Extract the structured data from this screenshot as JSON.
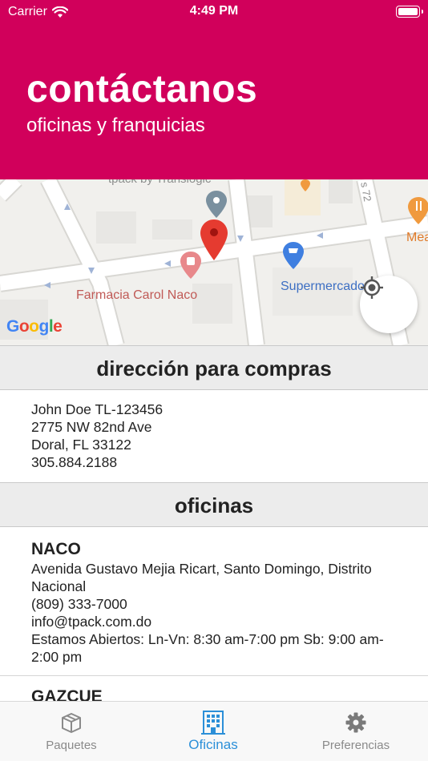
{
  "status_bar": {
    "carrier": "Carrier",
    "time": "4:49 PM"
  },
  "header": {
    "title": "contáctanos",
    "subtitle": "oficinas y franquicias"
  },
  "map": {
    "labels": {
      "farmacia": "Farmacia Carol Naco",
      "supermercado": "Supermercado ...o",
      "tpack": "tpack by Translogic",
      "me": "Mea",
      "street": "s 72"
    },
    "logo": "Google",
    "locate_icon": "crosshair-icon"
  },
  "sections": {
    "compras": "dirección para compras",
    "oficinas": "oficinas"
  },
  "shipping_address": {
    "line1": "John Doe TL-123456",
    "line2": "2775 NW 82nd Ave",
    "line3": "Doral, FL 33122",
    "phone": "305.884.2188"
  },
  "offices": [
    {
      "name": "NACO",
      "address": "Avenida Gustavo Mejia Ricart, Santo Domingo, Distrito Nacional",
      "phone": "(809) 333-7000",
      "email": "info@tpack.com.do",
      "hours": "Estamos Abiertos: Ln-Vn: 8:30 am-7:00 pm Sb: 9:00 am-2:00 pm"
    },
    {
      "name": "GAZCUE"
    }
  ],
  "tabs": [
    {
      "label": "Paquetes",
      "icon": "package-icon"
    },
    {
      "label": "Oficinas",
      "icon": "building-icon",
      "active": true
    },
    {
      "label": "Preferencias",
      "icon": "gear-icon"
    }
  ],
  "colors": {
    "brand": "#d1005b",
    "tab_active": "#2b8fd8"
  }
}
